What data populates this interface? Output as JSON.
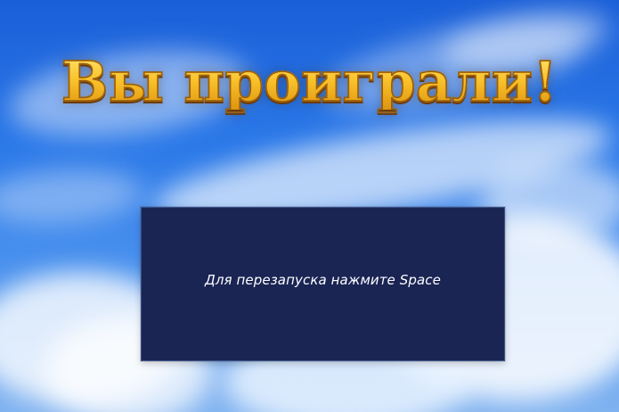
{
  "screen": {
    "title": "Вы проиграли!",
    "restart_message": "Для перезапуска нажмите Space"
  },
  "colors": {
    "sky": "#2a78e8",
    "title_fill": "#f5c128",
    "title_stroke": "#9b5f0a",
    "panel": "#1a2554",
    "panel_text": "#ffffff"
  }
}
